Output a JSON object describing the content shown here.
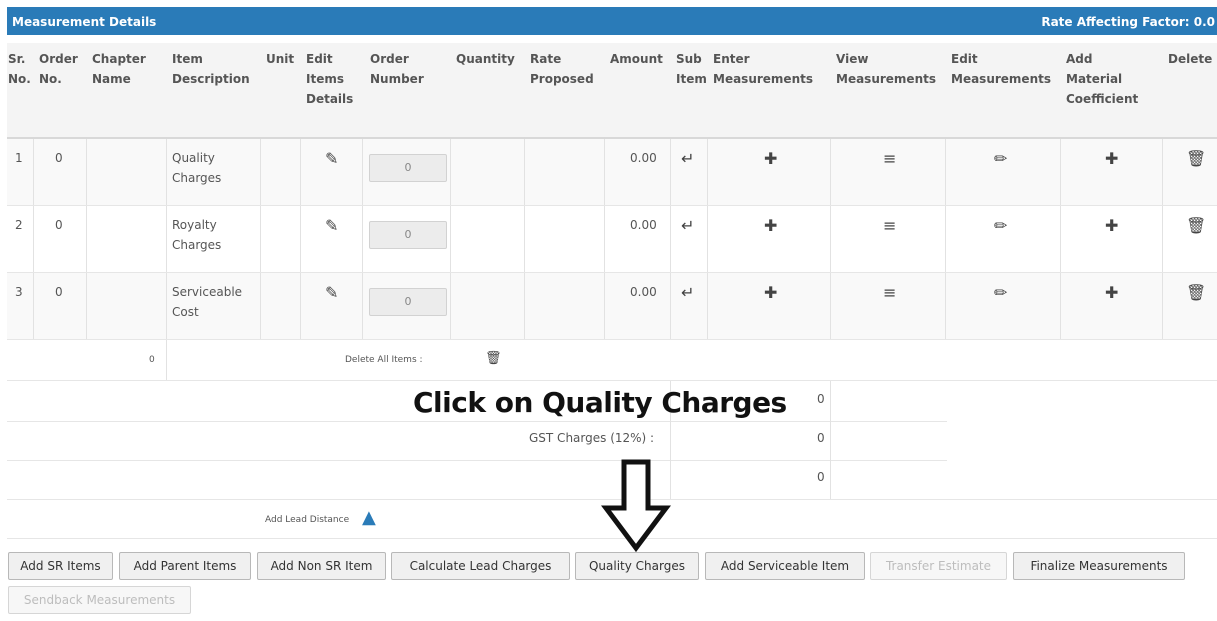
{
  "panel": {
    "title": "Measurement Details",
    "rate_factor": "Rate Affecting Factor: 0.0"
  },
  "columns": {
    "sr": [
      "Sr.",
      "No."
    ],
    "order_no": [
      "Order",
      "No."
    ],
    "chapter": [
      "Chapter",
      "Name"
    ],
    "item_desc": [
      "Item",
      "Description"
    ],
    "unit": [
      "Unit"
    ],
    "edit_items": [
      "Edit",
      "Items",
      "Details"
    ],
    "order_number": [
      "Order",
      "Number"
    ],
    "quantity": [
      "Quantity"
    ],
    "rate": [
      "Rate",
      "Proposed"
    ],
    "amount": [
      "Amount"
    ],
    "sub_item": [
      "Sub",
      "Item"
    ],
    "enter_meas": [
      "Enter",
      "Measurements"
    ],
    "view_meas": [
      "View",
      "Measurements"
    ],
    "edit_meas": [
      "Edit",
      "Measurements"
    ],
    "add_mat": [
      "Add",
      "Material",
      "Coefficient"
    ],
    "delete": [
      "Delete"
    ]
  },
  "rows": [
    {
      "sr": "1",
      "order_no": "0",
      "desc": [
        "Quality",
        "Charges"
      ],
      "order_number": "0",
      "amount": "0.00"
    },
    {
      "sr": "2",
      "order_no": "0",
      "desc": [
        "Royalty",
        "Charges"
      ],
      "order_number": "0",
      "amount": "0.00"
    },
    {
      "sr": "3",
      "order_no": "0",
      "desc": [
        "Serviceable",
        "Cost"
      ],
      "order_number": "0",
      "amount": "0.00"
    }
  ],
  "icons": {
    "edit_items": "edit-square-icon",
    "sub_item": "sub-item-arrow-icon",
    "enter": "plus-icon",
    "view": "list-icon",
    "edit": "pencil-icon",
    "add_material": "plus-icon",
    "delete": "trash-icon",
    "lead": "road-icon"
  },
  "summary": {
    "count": "0",
    "delete_all_label": "Delete All Items :",
    "row1_value": "0",
    "gst_label": "GST Charges (12%) :",
    "gst_value": "0",
    "row3_value": "0",
    "lead_label": "Add Lead Distance"
  },
  "buttons": {
    "add_sr": "Add SR Items",
    "add_parent": "Add Parent Items",
    "add_non_sr": "Add Non SR Item",
    "calc_lead": "Calculate Lead Charges",
    "quality": "Quality Charges",
    "add_serviceable": "Add Serviceable Item",
    "transfer": "Transfer Estimate",
    "finalize": "Finalize Measurements",
    "sendback": "Sendback Measurements"
  },
  "annotation": {
    "callout": "Click on Quality Charges"
  },
  "colors": {
    "header_blue": "#2a7bb8",
    "disabled_text": "#bdbdbd"
  }
}
